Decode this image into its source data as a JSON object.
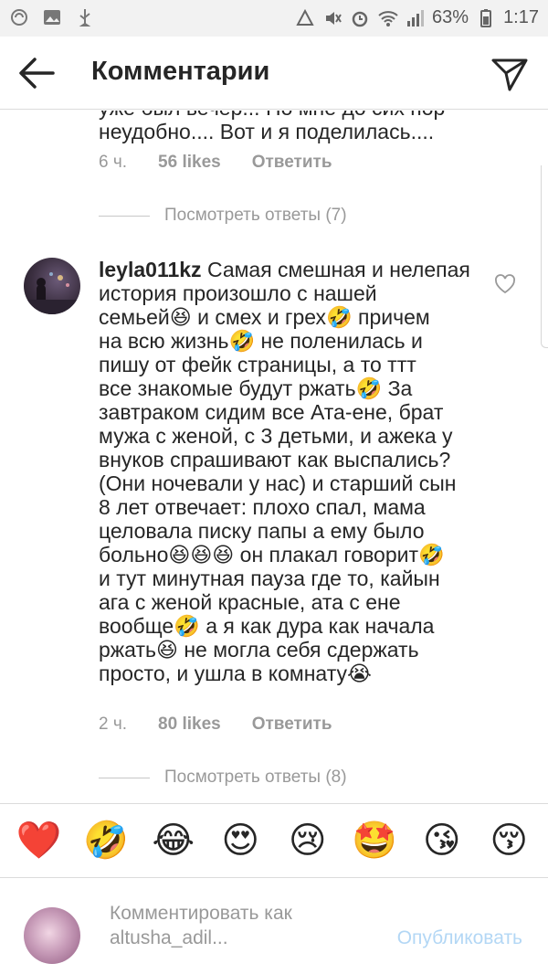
{
  "status_bar": {
    "battery": "63%",
    "time": "1:17"
  },
  "header": {
    "title": "Комментарии"
  },
  "previous_comment": {
    "partial_line": "уже был вечер... Но мне до сих пор",
    "last_line": "неудобно.... Вот и я поделилась....",
    "time": "6 ч.",
    "likes": "56 likes",
    "reply": "Ответить",
    "view_replies": "Посмотреть ответы (7)"
  },
  "comment": {
    "username": "leyla011kz",
    "lines": [
      "Самая смешная и нелепая",
      "история произошло с нашей",
      "семьей😆 и смех и грех🤣 причем",
      "на всю жизнь🤣 не поленилась и",
      "пишу от фейк страницы, а то ттт",
      "все знакомые будут ржать🤣 За",
      "завтраком сидим все Ата-ене, брат",
      "мужа с женой, с 3 детьми, и ажека у",
      "внуков спрашивают как выспались?",
      "(Они ночевали у нас) и старший сын",
      "8 лет отвечает: плохо спал, мама",
      "целовала писку папы а ему было",
      "больно😆😆😆 он плакал говорит🤣",
      "и тут минутная пауза где то, кайын",
      "ага с женой красные, ата с ене",
      "вообще🤣 а я как дура как начала",
      "ржать😆 не могла себя сдержать",
      "просто, и ушла в комнату😭"
    ],
    "time": "2 ч.",
    "likes": "80 likes",
    "reply": "Ответить",
    "view_replies": "Посмотреть ответы (8)"
  },
  "emoji_bar": [
    "❤️",
    "🤣",
    "😂",
    "😍",
    "😢",
    "🤩",
    "😘",
    "😚"
  ],
  "composer": {
    "placeholder": "Комментировать как altusha_adil...",
    "publish": "Опубликовать"
  },
  "colors": {
    "muted": "#999999",
    "publish_disabled": "#b3d7f5",
    "heart": "#ed4956"
  }
}
